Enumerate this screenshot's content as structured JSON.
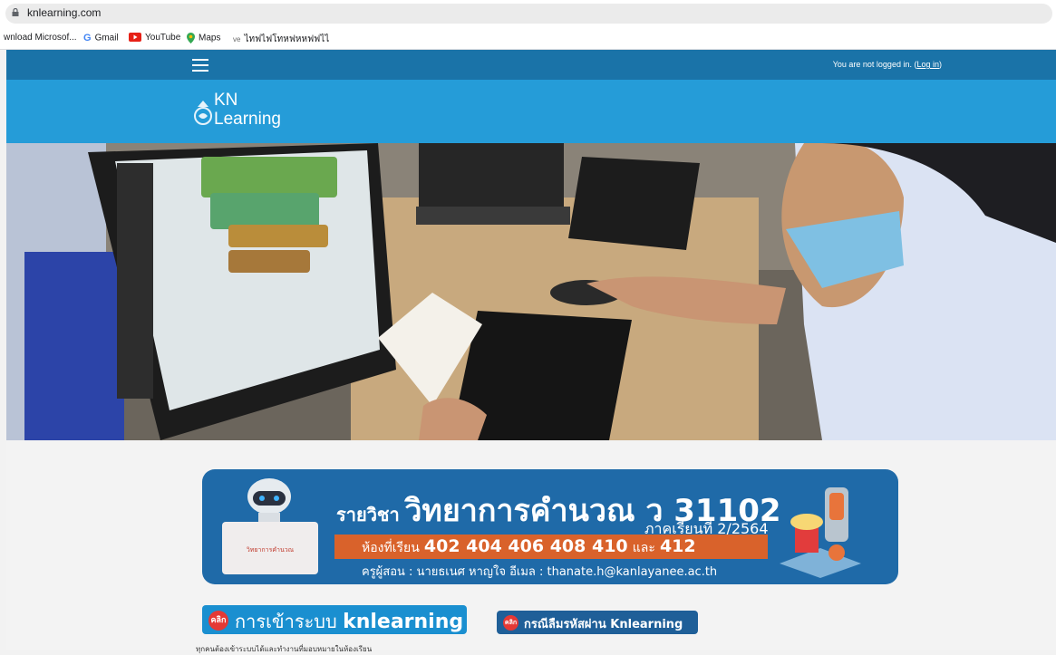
{
  "browser": {
    "url": "knlearning.com",
    "bookmarks": [
      {
        "label": "wnload Microsof..."
      },
      {
        "label": "Gmail"
      },
      {
        "label": "YouTube"
      },
      {
        "label": "Maps"
      },
      {
        "label": "ไทฟไฟโทหฟหหฟฟไไ"
      }
    ]
  },
  "navbar": {
    "login_prefix": "You are not logged in. (",
    "login_link": "Log in",
    "login_suffix": ")"
  },
  "site": {
    "logo_line1": "KN",
    "logo_line2": "Learning"
  },
  "banner": {
    "subject_prefix": "รายวิชา",
    "subject_title": "วิทยาการคำนวณ ว 31102",
    "term": "ภาคเรียนที่ 2/2564",
    "rooms_label": "ห้องที่เรียน",
    "rooms": "402 404 406 408 410",
    "rooms_and": "และ",
    "rooms_last": "412",
    "teacher": "ครูผู้สอน : นายธเนศ  หาญใจ อีเมล : thanate.h@kanlayanee.ac.th",
    "card_text": "วิทยาการคำนวณ"
  },
  "buttons": {
    "login_badge": "คลิก",
    "login_text": "การเข้าระบบ",
    "login_brand": "knlearning",
    "forgot_badge": "คลิก",
    "forgot_text": "กรณีลืมรหัสผ่าน",
    "forgot_brand": "Knlearning"
  },
  "note": "ทุกคนต้องเข้าระบบได้และทำงานที่มอบหมายในห้องเรียน",
  "colors": {
    "navbar": "#1a73a8",
    "header": "#259cd8",
    "banner": "#1f6aa8",
    "accent_orange": "#d9622b"
  },
  "icons": [
    "lock-icon",
    "google-icon",
    "youtube-icon",
    "maps-pin-icon",
    "hamburger-menu-icon",
    "kn-logo-icon",
    "robot-icon"
  ]
}
